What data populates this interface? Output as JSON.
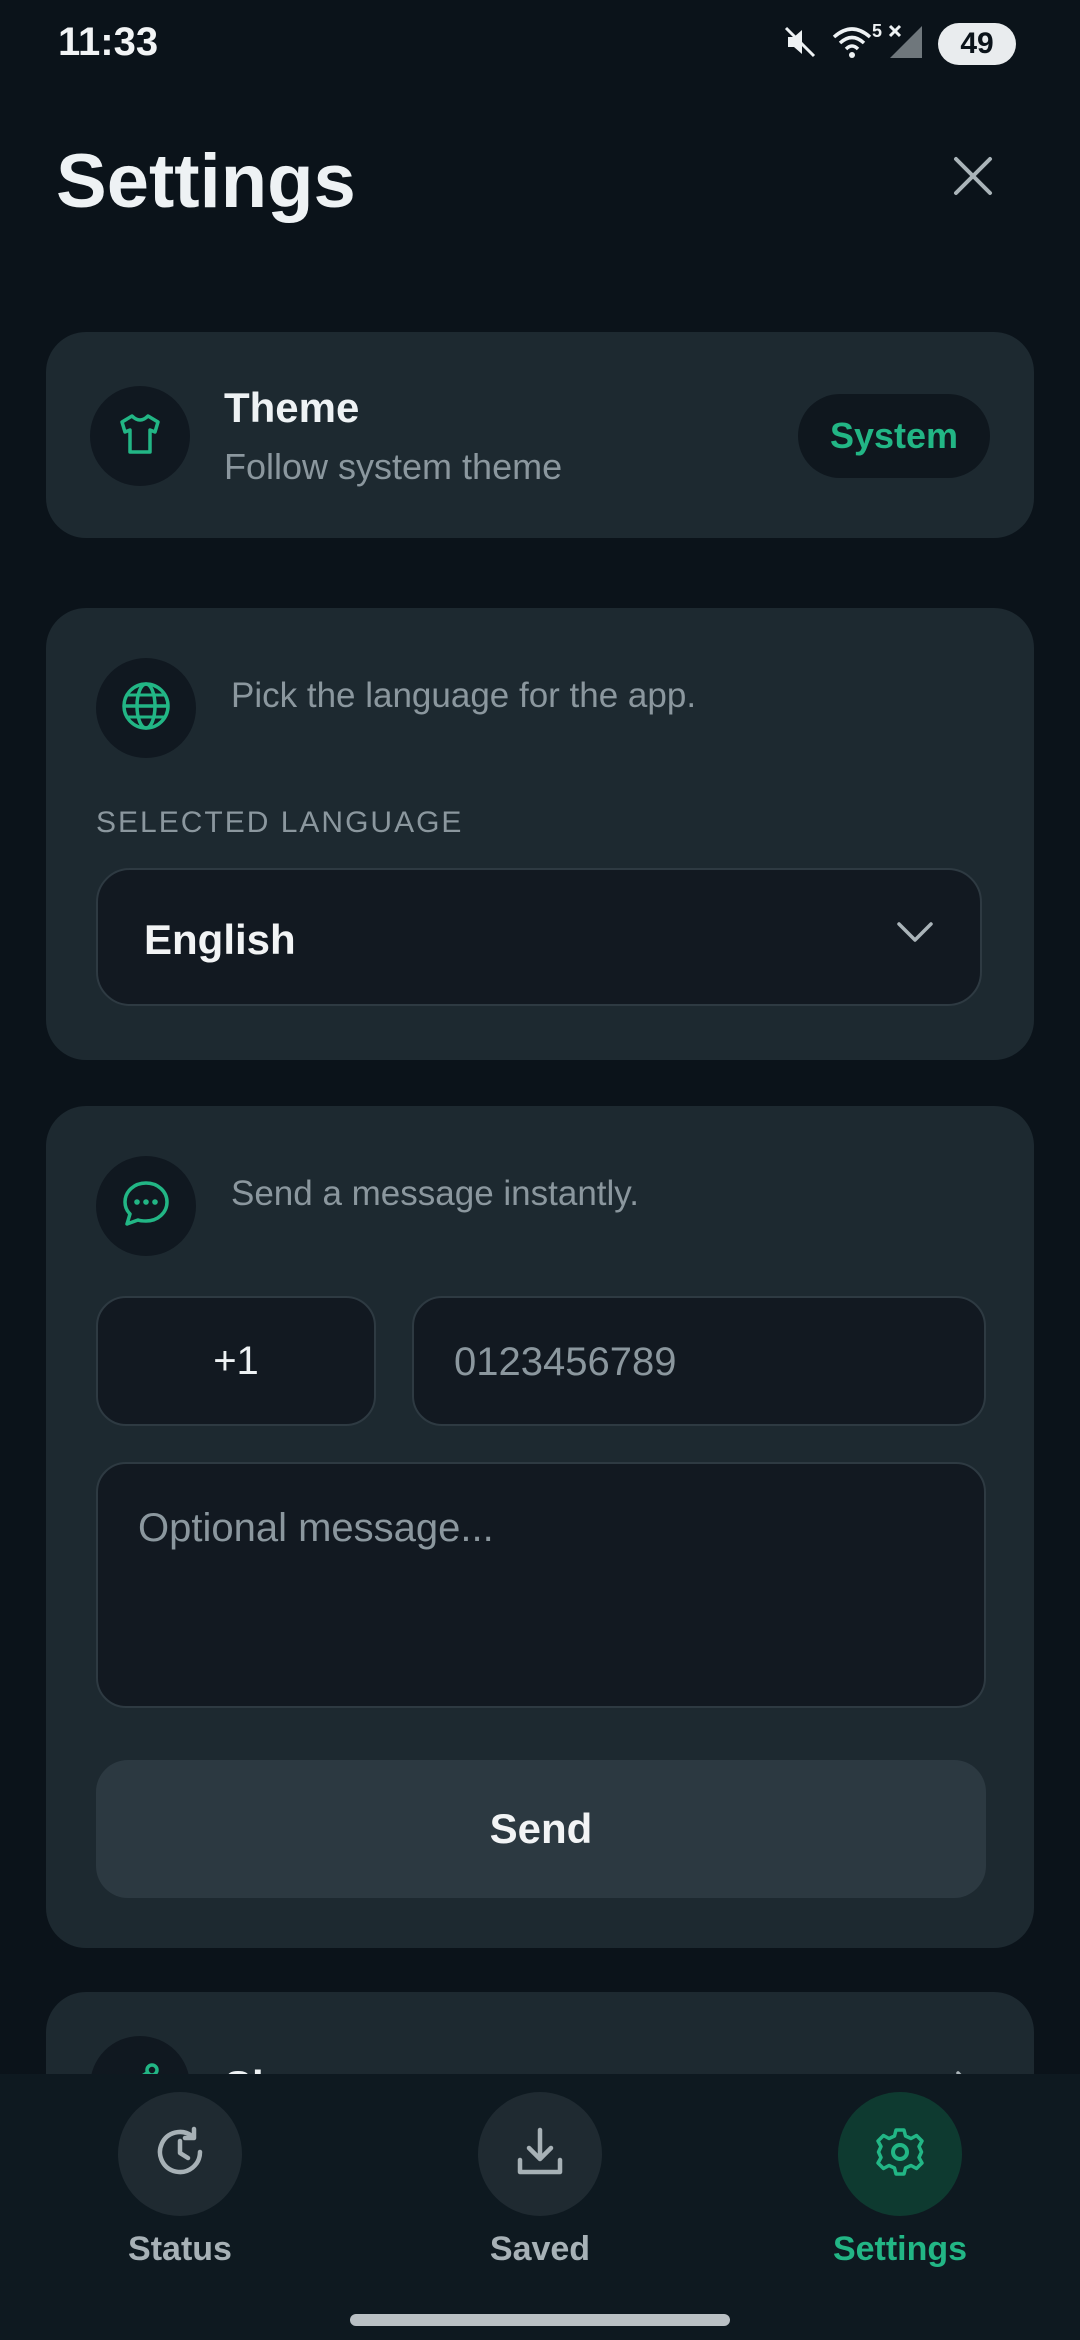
{
  "status_bar": {
    "time": "11:33",
    "battery": "49",
    "wifi_label": "5",
    "icons": [
      "mute-icon",
      "wifi-icon",
      "signal-icon",
      "battery-icon"
    ]
  },
  "header": {
    "title": "Settings",
    "close_icon": "close-icon"
  },
  "theme": {
    "title": "Theme",
    "subtitle": "Follow system theme",
    "value": "System",
    "icon": "tshirt-icon"
  },
  "language": {
    "description": "Pick the language for the app.",
    "section_label": "SELECTED LANGUAGE",
    "selected": "English",
    "icon": "globe-icon"
  },
  "message": {
    "description": "Send a message instantly.",
    "country_code": "+1",
    "phone_placeholder": "0123456789",
    "message_placeholder": "Optional message...",
    "send_label": "Send",
    "icon": "chat-bubble-icon"
  },
  "next_card": {
    "label": "Sh",
    "icon": "share-icon"
  },
  "bottom_nav": {
    "items": [
      {
        "label": "Status",
        "icon": "history-icon",
        "active": false
      },
      {
        "label": "Saved",
        "icon": "download-icon",
        "active": false
      },
      {
        "label": "Settings",
        "icon": "gear-icon",
        "active": true
      }
    ]
  },
  "colors": {
    "background": "#0b131a",
    "card": "#1d2930",
    "accent": "#22b685",
    "muted_text": "#8b979e"
  }
}
